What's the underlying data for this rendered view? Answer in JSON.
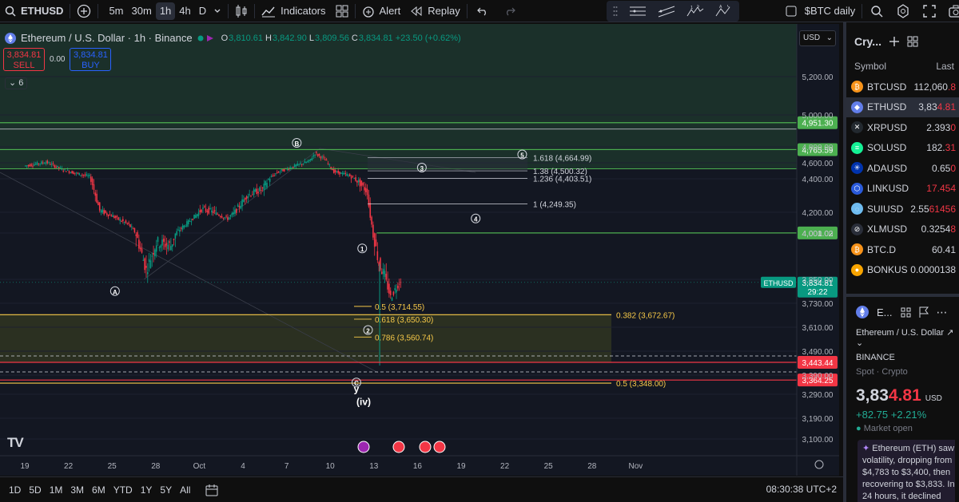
{
  "toolbar": {
    "symbol": "ETHUSD",
    "timeframes": [
      "5m",
      "30m",
      "1h",
      "4h",
      "D"
    ],
    "active_timeframe": "1h",
    "indicators_label": "Indicators",
    "alert_label": "Alert",
    "replay_label": "Replay",
    "layout_name": "$BTC daily"
  },
  "legend": {
    "title": "Ethereum / U.S. Dollar · 1h · Binance",
    "o": "3,810.61",
    "h": "3,842.90",
    "l": "3,809.56",
    "c": "3,834.81",
    "change": "+23.50 (+0.62%)",
    "sell_price": "3,834.81",
    "sell_label": "SELL",
    "spread": "0.00",
    "buy_price": "3,834.81",
    "buy_label": "BUY",
    "indicator_count": "6"
  },
  "currency": "USD",
  "chart_data": {
    "type": "candlestick",
    "x_ticks": [
      "19",
      "22",
      "25",
      "28",
      "Oct",
      "4",
      "7",
      "10",
      "13",
      "16",
      "19",
      "22",
      "25",
      "28",
      "Nov"
    ],
    "y_ticks": [
      5200,
      5000,
      4800,
      4600,
      4400,
      4200,
      4000,
      3850,
      3730,
      3610,
      3490,
      3390,
      3290,
      3190,
      3100
    ],
    "y_tick_labels": [
      "5,200.00",
      "5,000.00",
      "4,800.00",
      "4,600.00",
      "4,400.00",
      "4,200.00",
      "4,000.00",
      "3,850.00",
      "3,730.00",
      "3,610.00",
      "3,490.00",
      "3,390.00",
      "3,290.00",
      "3,190.00",
      "3,100.00"
    ],
    "price_path": [
      [
        0,
        4560
      ],
      [
        1.5,
        4610
      ],
      [
        2.6,
        4520
      ],
      [
        3.5,
        4470
      ],
      [
        4.5,
        4430
      ],
      [
        5.2,
        4210
      ],
      [
        6.0,
        4170
      ],
      [
        7.2,
        4080
      ],
      [
        8.4,
        3880
      ],
      [
        9.1,
        3970
      ],
      [
        10.1,
        3960
      ],
      [
        11.0,
        4070
      ],
      [
        12.2,
        4220
      ],
      [
        13.0,
        4200
      ],
      [
        14.0,
        4140
      ],
      [
        15.3,
        4300
      ],
      [
        16.4,
        4340
      ],
      [
        17.4,
        4480
      ],
      [
        18.6,
        4560
      ],
      [
        19.6,
        4620
      ],
      [
        20.0,
        4720
      ],
      [
        20.7,
        4640
      ],
      [
        21.3,
        4490
      ],
      [
        22.2,
        4450
      ],
      [
        23.0,
        4380
      ],
      [
        23.6,
        4320
      ],
      [
        24.0,
        4000
      ],
      [
        24.4,
        3900
      ],
      [
        24.8,
        3860
      ],
      [
        25.2,
        3760
      ],
      [
        25.9,
        3850
      ]
    ],
    "horizontal_levels": [
      {
        "label": "4,951.30",
        "value": 4951.3,
        "color": "#4caf50"
      },
      {
        "label": "4,765.59",
        "value": 4765.59,
        "color": "#4caf50"
      },
      {
        "label": "4,001.02",
        "value": 4001.02,
        "color": "#4caf50"
      },
      {
        "label": "3,443.44",
        "value": 3443.44,
        "color": "#f23645"
      },
      {
        "label": "3,364.25",
        "value": 3364.25,
        "color": "#f23645"
      }
    ],
    "fib_extension": [
      {
        "label": "1.618 (4,664.99)",
        "value": 4664.99
      },
      {
        "label": "1.38 (4,500.32)",
        "value": 4500.32
      },
      {
        "label": "1.236 (4,403.51)",
        "value": 4403.51
      },
      {
        "label": "1 (4,249.35)",
        "value": 4249.35
      }
    ],
    "fib_retracement_small": [
      {
        "label": "0.5 (3,714.55)",
        "value": 3714.55
      },
      {
        "label": "0.618 (3,650.30)",
        "value": 3650.3
      },
      {
        "label": "0.786 (3,560.74)",
        "value": 3560.74
      }
    ],
    "fib_retracement_large": [
      {
        "label": "0.382 (3,672.67)",
        "value": 3672.67
      },
      {
        "label": "0.5 (3,348.00)",
        "value": 3348.0
      }
    ],
    "wave_labels": [
      "A",
      "B",
      "C",
      "y",
      "(iv)",
      "1",
      "2",
      "3",
      "4",
      "5"
    ],
    "current_price": {
      "symbol": "ETHUSD",
      "price": "3,834.81",
      "countdown": "29:22",
      "value": 3834.81
    }
  },
  "bottom": {
    "ranges": [
      "1D",
      "5D",
      "1M",
      "3M",
      "6M",
      "YTD",
      "1Y",
      "5Y",
      "All"
    ],
    "clock": "08:30:38 UTC+2"
  },
  "watchlist": {
    "title": "Cry...",
    "col_symbol": "Symbol",
    "col_last": "Last",
    "rows": [
      {
        "symbol": "BTCUSD",
        "last_a": "112,060",
        "last_b": ".8",
        "color": "#f7931a",
        "icon": "₿"
      },
      {
        "symbol": "ETHUSD",
        "last_a": "3,83",
        "last_b": "4.81",
        "color": "#627eea",
        "icon": "◆",
        "selected": true
      },
      {
        "symbol": "XRPUSD",
        "last_a": "2.393",
        "last_b": "0",
        "color": "#23292f",
        "icon": "✕"
      },
      {
        "symbol": "SOLUSD",
        "last_a": "182.",
        "last_b": "31",
        "color": "#14f195",
        "icon": "≡"
      },
      {
        "symbol": "ADAUSD",
        "last_a": "0.65",
        "last_b": "0",
        "color": "#0033ad",
        "icon": "✳"
      },
      {
        "symbol": "LINKUSD",
        "last_a": "",
        "last_b": "17.454",
        "color": "#2a5ada",
        "icon": "⬡"
      },
      {
        "symbol": "SUIUSD",
        "last_a": "2.55",
        "last_b": "61456",
        "color": "#6fbcf0",
        "icon": "◌"
      },
      {
        "symbol": "XLMUSD",
        "last_a": "0.3254",
        "last_b": "8",
        "color": "#2a2e39",
        "icon": "⊘"
      },
      {
        "symbol": "BTC.D",
        "last_a": "60.41",
        "last_b": "",
        "color": "#f7931a",
        "icon": "₿"
      },
      {
        "symbol": "BONKUS",
        "last_a": "0.0000138",
        "last_b": "",
        "color": "#f7a400",
        "icon": "●"
      }
    ]
  },
  "details": {
    "short": "E...",
    "name": "Ethereum / U.S. Dollar",
    "exchange": "BINANCE",
    "type": "Spot · Crypto",
    "price_a": "3,83",
    "price_b": "4.81",
    "currency": "USD",
    "change": "+82.75",
    "change_pct": "+2.21%",
    "market": "Market open",
    "news": "Ethereum (ETH) saw volatility, dropping from $4,783 to $3,400, then recovering to $3,833. In 24 hours, it declined"
  }
}
